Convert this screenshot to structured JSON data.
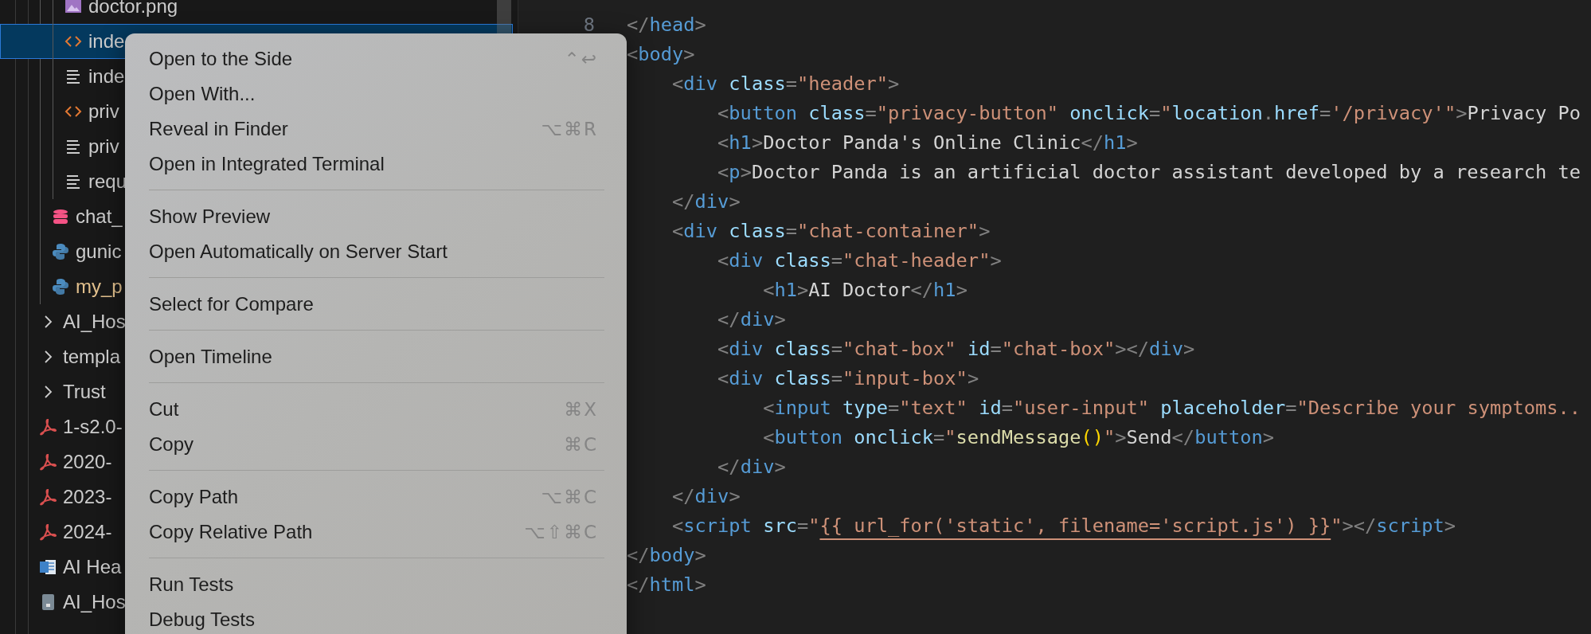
{
  "explorer": {
    "items": [
      {
        "children": [
          {
            "children": [
              {
                "name": "doctor.png",
                "kind": "image",
                "selected": false,
                "modified": false
              },
              {
                "name": "inde",
                "kind": "html",
                "selected": true,
                "modified": false
              },
              {
                "name": "inde",
                "kind": "text",
                "selected": false,
                "modified": false
              },
              {
                "name": "priv",
                "kind": "html",
                "selected": false,
                "modified": false
              },
              {
                "name": "priv",
                "kind": "text",
                "selected": false,
                "modified": false
              },
              {
                "name": "requ",
                "kind": "text",
                "selected": false,
                "modified": false
              }
            ]
          },
          {
            "name": "chat_",
            "kind": "database",
            "selected": false,
            "modified": false
          },
          {
            "name": "gunic",
            "kind": "python",
            "selected": false,
            "modified": false
          },
          {
            "name": "my_p",
            "kind": "python",
            "selected": false,
            "modified": true
          }
        ]
      },
      {
        "name": "AI_Hos",
        "kind": "folder",
        "selected": false,
        "modified": false,
        "expanded": false
      },
      {
        "name": "templa",
        "kind": "folder",
        "selected": false,
        "modified": false,
        "expanded": false
      },
      {
        "name": "Trust",
        "kind": "folder",
        "selected": false,
        "modified": false,
        "expanded": false
      },
      {
        "name": "1-s2.0-",
        "kind": "pdf",
        "selected": false,
        "modified": false
      },
      {
        "name": "2020-",
        "kind": "pdf",
        "selected": false,
        "modified": false
      },
      {
        "name": "2023-",
        "kind": "pdf",
        "selected": false,
        "modified": false
      },
      {
        "name": "2024-",
        "kind": "pdf",
        "selected": false,
        "modified": false
      },
      {
        "name": "AI Hea",
        "kind": "word",
        "selected": false,
        "modified": false
      },
      {
        "name": "AI_Hos",
        "kind": "locked",
        "selected": false,
        "modified": false
      }
    ]
  },
  "editor": {
    "lines": [
      {
        "number": "8",
        "tokens": [
          {
            "kind": "punct",
            "text": "</"
          },
          {
            "kind": "tag",
            "text": "head"
          },
          {
            "kind": "punct",
            "text": ">"
          }
        ]
      },
      {
        "tokens": [
          {
            "kind": "punct",
            "text": "<"
          },
          {
            "kind": "tag",
            "text": "body"
          },
          {
            "kind": "punct",
            "text": ">"
          }
        ]
      },
      {
        "tokens": [
          {
            "kind": "punct",
            "text": "    <"
          },
          {
            "kind": "tag",
            "text": "div"
          },
          {
            "kind": "attr",
            "text": " class"
          },
          {
            "kind": "punct",
            "text": "="
          },
          {
            "kind": "string",
            "text": "\"header\""
          },
          {
            "kind": "punct",
            "text": ">"
          }
        ]
      },
      {
        "tokens": [
          {
            "kind": "punct",
            "text": "        <"
          },
          {
            "kind": "tag",
            "text": "button"
          },
          {
            "kind": "attr",
            "text": " class"
          },
          {
            "kind": "punct",
            "text": "="
          },
          {
            "kind": "string",
            "text": "\"privacy-button\""
          },
          {
            "kind": "attr",
            "text": " onclick"
          },
          {
            "kind": "punct",
            "text": "="
          },
          {
            "kind": "string",
            "text": "\""
          },
          {
            "kind": "attr",
            "text": "location"
          },
          {
            "kind": "punct",
            "text": "."
          },
          {
            "kind": "attr",
            "text": "href"
          },
          {
            "kind": "punct",
            "text": "="
          },
          {
            "kind": "string",
            "text": "'/privacy'\""
          },
          {
            "kind": "punct",
            "text": ">"
          },
          {
            "kind": "text",
            "text": "Privacy Po"
          }
        ]
      },
      {
        "tokens": [
          {
            "kind": "punct",
            "text": "        <"
          },
          {
            "kind": "tag",
            "text": "h1"
          },
          {
            "kind": "punct",
            "text": ">"
          },
          {
            "kind": "text",
            "text": "Doctor Panda's Online Clinic"
          },
          {
            "kind": "punct",
            "text": "</"
          },
          {
            "kind": "tag",
            "text": "h1"
          },
          {
            "kind": "punct",
            "text": ">"
          }
        ]
      },
      {
        "tokens": [
          {
            "kind": "punct",
            "text": "        <"
          },
          {
            "kind": "tag",
            "text": "p"
          },
          {
            "kind": "punct",
            "text": ">"
          },
          {
            "kind": "text",
            "text": "Doctor Panda is an artificial doctor assistant developed by a research te"
          }
        ]
      },
      {
        "tokens": [
          {
            "kind": "punct",
            "text": "    </"
          },
          {
            "kind": "tag",
            "text": "div"
          },
          {
            "kind": "punct",
            "text": ">"
          }
        ]
      },
      {
        "tokens": [
          {
            "kind": "punct",
            "text": "    <"
          },
          {
            "kind": "tag",
            "text": "div"
          },
          {
            "kind": "attr",
            "text": " class"
          },
          {
            "kind": "punct",
            "text": "="
          },
          {
            "kind": "string",
            "text": "\"chat-container\""
          },
          {
            "kind": "punct",
            "text": ">"
          }
        ]
      },
      {
        "tokens": [
          {
            "kind": "punct",
            "text": "        <"
          },
          {
            "kind": "tag",
            "text": "div"
          },
          {
            "kind": "attr",
            "text": " class"
          },
          {
            "kind": "punct",
            "text": "="
          },
          {
            "kind": "string",
            "text": "\"chat-header\""
          },
          {
            "kind": "punct",
            "text": ">"
          }
        ]
      },
      {
        "tokens": [
          {
            "kind": "punct",
            "text": "            <"
          },
          {
            "kind": "tag",
            "text": "h1"
          },
          {
            "kind": "punct",
            "text": ">"
          },
          {
            "kind": "text",
            "text": "AI Doctor"
          },
          {
            "kind": "punct",
            "text": "</"
          },
          {
            "kind": "tag",
            "text": "h1"
          },
          {
            "kind": "punct",
            "text": ">"
          }
        ]
      },
      {
        "tokens": [
          {
            "kind": "punct",
            "text": "        </"
          },
          {
            "kind": "tag",
            "text": "div"
          },
          {
            "kind": "punct",
            "text": ">"
          }
        ]
      },
      {
        "tokens": [
          {
            "kind": "punct",
            "text": "        <"
          },
          {
            "kind": "tag",
            "text": "div"
          },
          {
            "kind": "attr",
            "text": " class"
          },
          {
            "kind": "punct",
            "text": "="
          },
          {
            "kind": "string",
            "text": "\"chat-box\""
          },
          {
            "kind": "attr",
            "text": " id"
          },
          {
            "kind": "punct",
            "text": "="
          },
          {
            "kind": "string",
            "text": "\"chat-box\""
          },
          {
            "kind": "punct",
            "text": "></"
          },
          {
            "kind": "tag",
            "text": "div"
          },
          {
            "kind": "punct",
            "text": ">"
          }
        ]
      },
      {
        "tokens": [
          {
            "kind": "punct",
            "text": "        <"
          },
          {
            "kind": "tag",
            "text": "div"
          },
          {
            "kind": "attr",
            "text": " class"
          },
          {
            "kind": "punct",
            "text": "="
          },
          {
            "kind": "string",
            "text": "\"input-box\""
          },
          {
            "kind": "punct",
            "text": ">"
          }
        ]
      },
      {
        "tokens": [
          {
            "kind": "punct",
            "text": "            <"
          },
          {
            "kind": "tag",
            "text": "input"
          },
          {
            "kind": "attr",
            "text": " type"
          },
          {
            "kind": "punct",
            "text": "="
          },
          {
            "kind": "string",
            "text": "\"text\""
          },
          {
            "kind": "attr",
            "text": " id"
          },
          {
            "kind": "punct",
            "text": "="
          },
          {
            "kind": "string",
            "text": "\"user-input\""
          },
          {
            "kind": "attr",
            "text": " placeholder"
          },
          {
            "kind": "punct",
            "text": "="
          },
          {
            "kind": "string",
            "text": "\"Describe your symptoms.."
          }
        ]
      },
      {
        "tokens": [
          {
            "kind": "punct",
            "text": "            <"
          },
          {
            "kind": "tag",
            "text": "button"
          },
          {
            "kind": "attr",
            "text": " onclick"
          },
          {
            "kind": "punct",
            "text": "="
          },
          {
            "kind": "string",
            "text": "\""
          },
          {
            "kind": "func",
            "text": "sendMessage"
          },
          {
            "kind": "bracket",
            "text": "()"
          },
          {
            "kind": "string",
            "text": "\""
          },
          {
            "kind": "punct",
            "text": ">"
          },
          {
            "kind": "text",
            "text": "Send"
          },
          {
            "kind": "punct",
            "text": "</"
          },
          {
            "kind": "tag",
            "text": "button"
          },
          {
            "kind": "punct",
            "text": ">"
          }
        ]
      },
      {
        "tokens": [
          {
            "kind": "punct",
            "text": "        </"
          },
          {
            "kind": "tag",
            "text": "div"
          },
          {
            "kind": "punct",
            "text": ">"
          }
        ]
      },
      {
        "tokens": [
          {
            "kind": "punct",
            "text": "    </"
          },
          {
            "kind": "tag",
            "text": "div"
          },
          {
            "kind": "punct",
            "text": ">"
          }
        ]
      },
      {
        "tokens": [
          {
            "kind": "punct",
            "text": "    <"
          },
          {
            "kind": "tag",
            "text": "script"
          },
          {
            "kind": "attr",
            "text": " src"
          },
          {
            "kind": "punct",
            "text": "="
          },
          {
            "kind": "string",
            "text": "\""
          },
          {
            "kind": "template",
            "text": "{{ url_for('static', filename='script.js') }}"
          },
          {
            "kind": "string",
            "text": "\""
          },
          {
            "kind": "punct",
            "text": "></"
          },
          {
            "kind": "tag",
            "text": "script"
          },
          {
            "kind": "punct",
            "text": ">"
          }
        ]
      },
      {
        "tokens": [
          {
            "kind": "punct",
            "text": "</"
          },
          {
            "kind": "tag",
            "text": "body"
          },
          {
            "kind": "punct",
            "text": ">"
          }
        ]
      },
      {
        "tokens": [
          {
            "kind": "punct",
            "text": "</"
          },
          {
            "kind": "tag",
            "text": "html"
          },
          {
            "kind": "punct",
            "text": ">"
          }
        ]
      }
    ]
  },
  "context_menu": {
    "sections": [
      {
        "items": [
          {
            "label": "Open to the Side",
            "shortcut": "⌃↩"
          },
          {
            "label": "Open With..."
          },
          {
            "label": "Reveal in Finder",
            "shortcut": "⌥⌘R"
          },
          {
            "label": "Open in Integrated Terminal"
          }
        ]
      },
      {
        "items": [
          {
            "label": "Show Preview"
          },
          {
            "label": "Open Automatically on Server Start"
          }
        ]
      },
      {
        "items": [
          {
            "label": "Select for Compare"
          }
        ]
      },
      {
        "items": [
          {
            "label": "Open Timeline"
          }
        ]
      },
      {
        "items": [
          {
            "label": "Cut",
            "shortcut": "⌘X"
          },
          {
            "label": "Copy",
            "shortcut": "⌘C"
          }
        ]
      },
      {
        "items": [
          {
            "label": "Copy Path",
            "shortcut": "⌥⌘C"
          },
          {
            "label": "Copy Relative Path",
            "shortcut": "⌥⇧⌘C"
          }
        ]
      },
      {
        "items": [
          {
            "label": "Run Tests"
          },
          {
            "label": "Debug Tests"
          }
        ]
      }
    ]
  }
}
